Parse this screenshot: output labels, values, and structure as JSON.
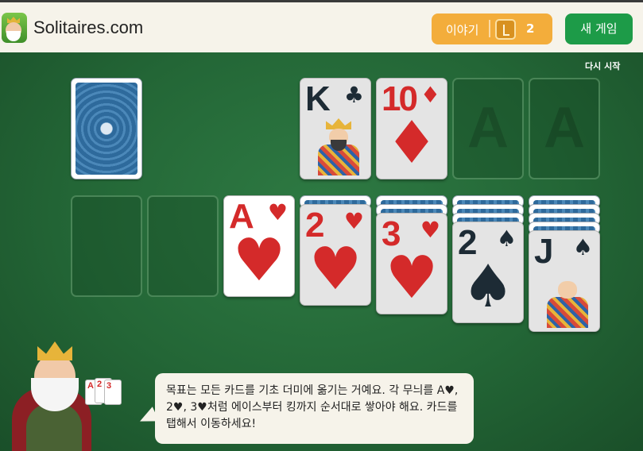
{
  "header": {
    "site_title": "Solitaires.com",
    "story_label": "이야기",
    "story_count": "2",
    "new_game_label": "새 게임",
    "logo_icon": "king-logo-icon"
  },
  "table": {
    "restart_label": "다시 시작",
    "foundations": [
      {
        "rank": "K",
        "suit": "♣",
        "color": "black"
      },
      {
        "rank": "10",
        "suit": "♦",
        "color": "red"
      },
      {
        "empty_label": "A"
      },
      {
        "empty_label": "A"
      }
    ],
    "tableau": [
      {
        "face_down": 0,
        "rank": null
      },
      {
        "face_down": 0,
        "rank": null
      },
      {
        "face_down": 0,
        "rank": "A",
        "suit": "♥",
        "color": "red"
      },
      {
        "face_down": 1,
        "rank": "2",
        "suit": "♥",
        "color": "red"
      },
      {
        "face_down": 2,
        "rank": "3",
        "suit": "♥",
        "color": "red"
      },
      {
        "face_down": 3,
        "rank": "2",
        "suit": "♠",
        "color": "black"
      },
      {
        "face_down": 4,
        "rank": "J",
        "suit": "♠",
        "color": "black"
      }
    ]
  },
  "tutorial": {
    "message": "목표는 모든 카드를 기초 더미에 옮기는 거예요. 각 무늬를 A♥, 2♥, 3♥처럼 에이스부터 킹까지 순서대로 쌓아야 해요. 카드를 탭해서 이동하세요!",
    "mascot_cards": [
      "A",
      "2",
      "3"
    ]
  }
}
